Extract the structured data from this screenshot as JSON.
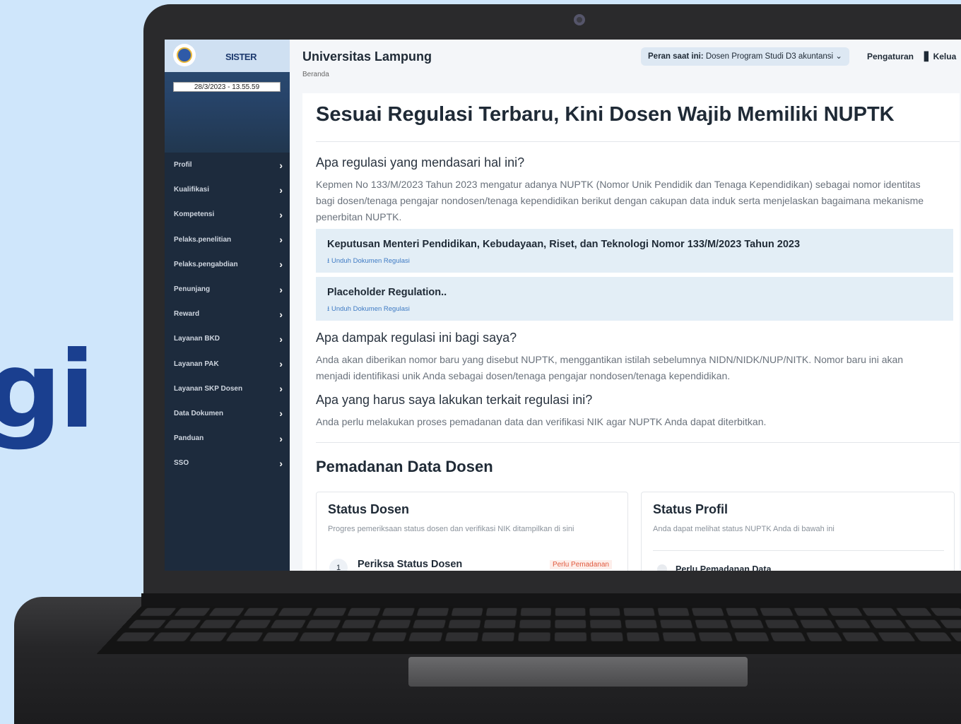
{
  "background": {
    "large_text": "gi"
  },
  "sidebar": {
    "brand": "SISTER",
    "datetime": "28/3/2023 - 13.55.59",
    "items": [
      {
        "label": "Profil"
      },
      {
        "label": "Kualifikasi"
      },
      {
        "label": "Kompetensi"
      },
      {
        "label": "Pelaks.penelitian"
      },
      {
        "label": "Pelaks.pengabdian"
      },
      {
        "label": "Penunjang"
      },
      {
        "label": "Reward"
      },
      {
        "label": "Layanan BKD"
      },
      {
        "label": "Layanan PAK"
      },
      {
        "label": "Layanan SKP Dosen"
      },
      {
        "label": "Data Dokumen"
      },
      {
        "label": "Panduan"
      },
      {
        "label": "SSO"
      }
    ]
  },
  "header": {
    "title": "Universitas Lampung",
    "breadcrumb": "Beranda",
    "role_label": "Peran saat ini:",
    "role_value": "Dosen Program Studi D3 akuntansi",
    "settings": "Pengaturan",
    "logout": "Kelua"
  },
  "content": {
    "headline": "Sesuai Regulasi Terbaru, Kini Dosen Wajib Memiliki NUPTK",
    "q1": "Apa regulasi yang mendasari hal ini?",
    "p1": "Kepmen No 133/M/2023 Tahun 2023 mengatur adanya NUPTK (Nomor Unik Pendidik dan Tenaga Kependidikan) sebagai nomor identitas bagi dosen/tenaga pengajar nondosen/tenaga kependidikan berikut dengan cakupan data induk serta menjelaskan bagaimana mekanisme penerbitan NUPTK.",
    "regulations": [
      {
        "title": "Keputusan Menteri Pendidikan, Kebudayaan, Riset, dan Teknologi Nomor 133/M/2023 Tahun 2023",
        "download": "Unduh Dokumen Regulasi"
      },
      {
        "title": "Placeholder Regulation..",
        "download": "Unduh Dokumen Regulasi"
      }
    ],
    "q2": "Apa dampak regulasi ini bagi saya?",
    "p2": "Anda akan diberikan nomor baru yang disebut NUPTK, menggantikan istilah sebelumnya NIDN/NIDK/NUP/NITK. Nomor baru ini akan menjadi identifikasi unik Anda sebagai dosen/tenaga pengajar nondosen/tenaga kependidikan.",
    "q3": "Apa yang harus saya lakukan terkait regulasi ini?",
    "p3": "Anda perlu melakukan proses pemadanan data dan verifikasi NIK agar NUPTK Anda dapat diterbitkan.",
    "section_title": "Pemadanan Data Dosen",
    "status_dosen": {
      "title": "Status Dosen",
      "subtitle": "Progres pemeriksaan status dosen dan verifikasi NIK ditampilkan di sini",
      "step_number": "1",
      "step_label": "Periksa Status Dosen",
      "badge": "Perlu Pemadanan"
    },
    "status_profil": {
      "title": "Status Profil",
      "subtitle": "Anda dapat melihat status NUPTK Anda di bawah ini",
      "option": "Perlu Pemadanan Data"
    }
  }
}
